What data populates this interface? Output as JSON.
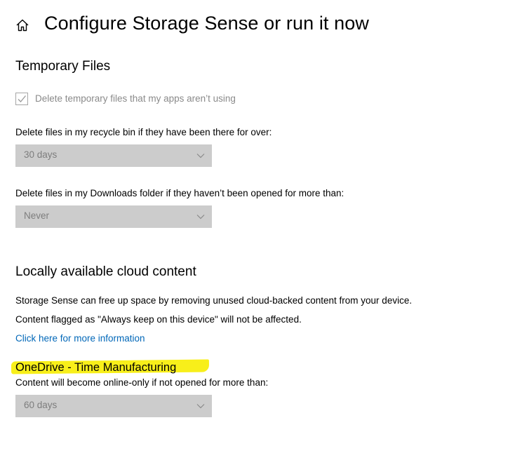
{
  "header": {
    "title": "Configure Storage Sense or run it now",
    "home_icon": "home-icon"
  },
  "temporary_files": {
    "heading": "Temporary Files",
    "checkbox_label": "Delete temporary files that my apps aren’t using",
    "checkbox_checked": true,
    "recycle_bin_label": "Delete files in my recycle bin if they have been there for over:",
    "recycle_bin_value": "30 days",
    "downloads_label": "Delete files in my Downloads folder if they haven’t been opened for more than:",
    "downloads_value": "Never"
  },
  "cloud_content": {
    "heading": "Locally available cloud content",
    "description_line1": "Storage Sense can free up space by removing unused cloud-backed content from your device.",
    "description_line2": "Content flagged as \"Always keep on this device\" will not be affected.",
    "more_info_link": "Click here for more information",
    "onedrive_heading": "OneDrive - Time Manufacturing",
    "onedrive_label": "Content will become online-only if not opened for more than:",
    "onedrive_value": "60 days"
  },
  "colors": {
    "highlight": "#f8ef1a",
    "link": "#0067b8",
    "dropdown_bg": "#cccccc",
    "disabled_text": "#8a8a8a"
  }
}
